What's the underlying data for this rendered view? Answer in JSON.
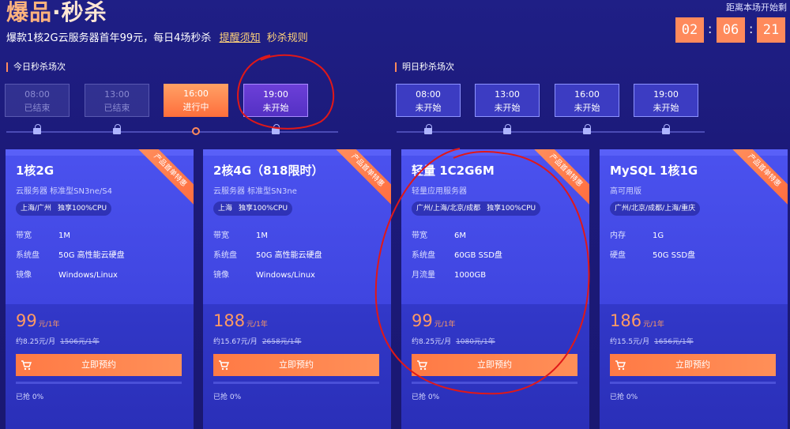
{
  "header": {
    "title_part1": "爆品",
    "title_dot": "·",
    "title_part2": "秒杀",
    "subtitle": "爆款1核2G云服务器首年99元，每日4场秒杀",
    "notify_link": "提醒须知",
    "rules_link": "秒杀规则",
    "countdown_label": "距离本场开始剩",
    "countdown": {
      "hours": "02",
      "minutes": "06",
      "seconds": "21",
      "sep": ":"
    }
  },
  "today": {
    "label": "今日秒杀场次",
    "sessions": [
      {
        "time": "08:00",
        "status": "已结束"
      },
      {
        "time": "13:00",
        "status": "已结束"
      },
      {
        "time": "16:00",
        "status": "进行中"
      },
      {
        "time": "19:00",
        "status": "未开始"
      }
    ]
  },
  "tomorrow": {
    "label": "明日秒杀场次",
    "sessions": [
      {
        "time": "08:00",
        "status": "未开始"
      },
      {
        "time": "13:00",
        "status": "未开始"
      },
      {
        "time": "16:00",
        "status": "未开始"
      },
      {
        "time": "19:00",
        "status": "未开始"
      }
    ]
  },
  "cards": [
    {
      "ribbon": "产品首单特惠",
      "title": "1核2G",
      "subtitle": "云服务器 标准型SN3ne/S4",
      "tag_region": "上海/广州",
      "tag_cpu": "独享100%CPU",
      "specs": [
        {
          "k": "带宽",
          "v": "1M"
        },
        {
          "k": "系统盘",
          "v": "50G 高性能云硬盘"
        },
        {
          "k": "镜像",
          "v": "Windows/Linux"
        }
      ],
      "price": "99",
      "price_unit": "元/1年",
      "per_month": "约8.25元/月",
      "orig_price": "1506元/1年",
      "button": "立即预约",
      "sold": "已抢 0%",
      "progress": 0
    },
    {
      "ribbon": "产品首单特惠",
      "title": "2核4G（818限时）",
      "subtitle": "云服务器 标准型SN3ne",
      "tag_region": "上海",
      "tag_cpu": "独享100%CPU",
      "specs": [
        {
          "k": "带宽",
          "v": "1M"
        },
        {
          "k": "系统盘",
          "v": "50G 高性能云硬盘"
        },
        {
          "k": "镜像",
          "v": "Windows/Linux"
        }
      ],
      "price": "188",
      "price_unit": "元/1年",
      "per_month": "约15.67元/月",
      "orig_price": "2658元/1年",
      "button": "立即预约",
      "sold": "已抢 0%",
      "progress": 0
    },
    {
      "ribbon": "产品首单特惠",
      "title": "轻量 1C2G6M",
      "subtitle": "轻量应用服务器",
      "tag_region": "广州/上海/北京/成都",
      "tag_cpu": "独享100%CPU",
      "specs": [
        {
          "k": "带宽",
          "v": "6M"
        },
        {
          "k": "系统盘",
          "v": "60GB SSD盘"
        },
        {
          "k": "月流量",
          "v": "1000GB"
        }
      ],
      "price": "99",
      "price_unit": "元/1年",
      "per_month": "约8.25元/月",
      "orig_price": "1080元/1年",
      "button": "立即预约",
      "sold": "已抢 0%",
      "progress": 0
    },
    {
      "ribbon": "产品首单特惠",
      "title": "MySQL 1核1G",
      "subtitle": "高可用版",
      "tag_region": "广州/北京/成都/上海/重庆",
      "tag_cpu": "",
      "specs": [
        {
          "k": "内存",
          "v": "1G"
        },
        {
          "k": "硬盘",
          "v": "50G SSD盘"
        }
      ],
      "price": "186",
      "price_unit": "元/1年",
      "per_month": "约15.5元/月",
      "orig_price": "1656元/1年",
      "button": "立即预约",
      "sold": "已抢 0%",
      "progress": 0
    }
  ],
  "colors": {
    "accent_orange": "#ff8a5c",
    "annotation_red": "#e01818",
    "background": "#1f1f86"
  }
}
